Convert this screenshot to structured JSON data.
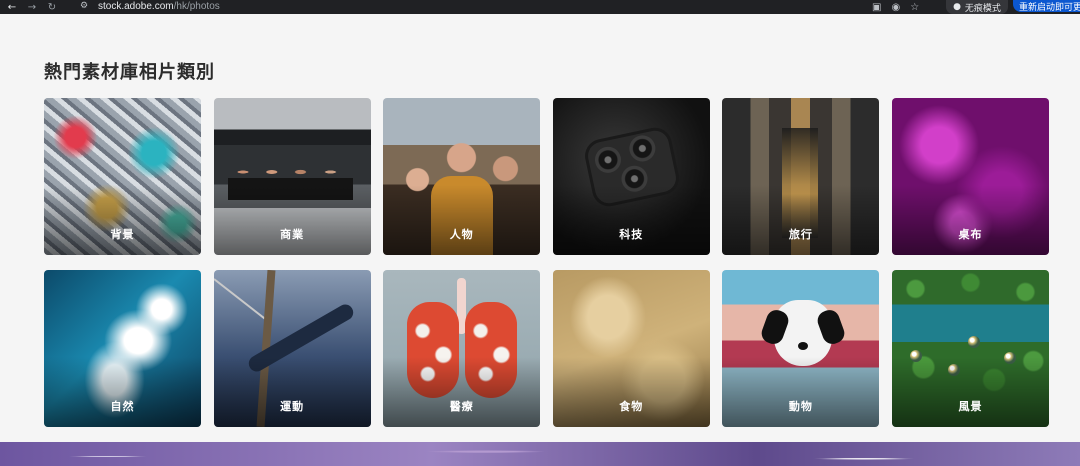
{
  "browser": {
    "url_host": "stock.adobe.com",
    "url_path": "/hk/photos",
    "incognito_label": "无痕模式",
    "update_label": "重新启动即可更新",
    "icons": [
      "back-icon",
      "forward-icon",
      "reload-icon",
      "site-info-icon",
      "translate-icon",
      "eye-off-icon",
      "star-icon",
      "incognito-icon"
    ]
  },
  "section": {
    "title": "熱門素材庫相片類別"
  },
  "categories": [
    {
      "label": "背景"
    },
    {
      "label": "商業"
    },
    {
      "label": "人物"
    },
    {
      "label": "科技"
    },
    {
      "label": "旅行"
    },
    {
      "label": "桌布"
    },
    {
      "label": "自然"
    },
    {
      "label": "運動"
    },
    {
      "label": "醫療"
    },
    {
      "label": "食物"
    },
    {
      "label": "動物"
    },
    {
      "label": "風景"
    }
  ]
}
